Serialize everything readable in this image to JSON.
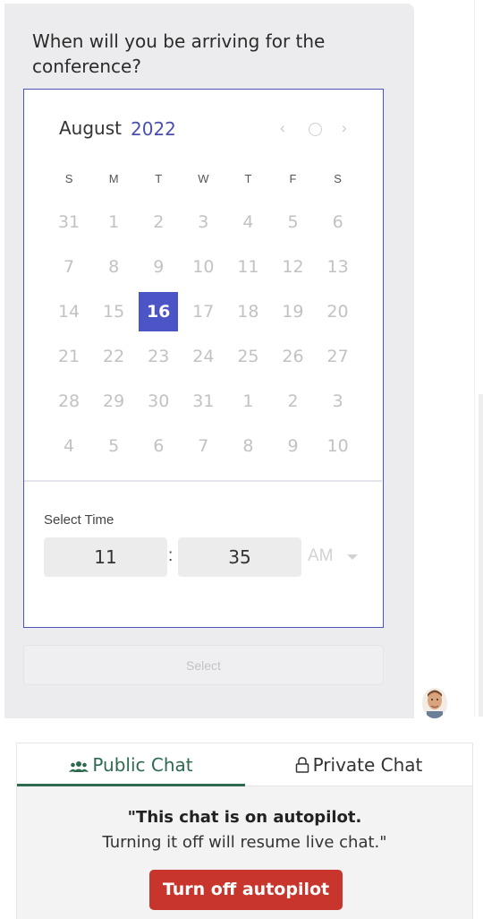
{
  "chat": {
    "question": "When will you be arriving for the conference?"
  },
  "calendar": {
    "month": "August",
    "year": "2022",
    "nav": {
      "prev": "‹",
      "next": "›"
    },
    "weekdays": [
      "S",
      "M",
      "T",
      "W",
      "T",
      "F",
      "S"
    ],
    "weeks": [
      [
        "31",
        "1",
        "2",
        "3",
        "4",
        "5",
        "6"
      ],
      [
        "7",
        "8",
        "9",
        "10",
        "11",
        "12",
        "13"
      ],
      [
        "14",
        "15",
        "16",
        "17",
        "18",
        "19",
        "20"
      ],
      [
        "21",
        "22",
        "23",
        "24",
        "25",
        "26",
        "27"
      ],
      [
        "28",
        "29",
        "30",
        "31",
        "1",
        "2",
        "3"
      ],
      [
        "4",
        "5",
        "6",
        "7",
        "8",
        "9",
        "10"
      ]
    ],
    "selected_day": "16",
    "accent_color": "#4b55c6"
  },
  "time": {
    "label": "Select Time",
    "hour": "11",
    "separator": ":",
    "minute": "35",
    "meridiem": "AM"
  },
  "actions": {
    "select_label": "Select"
  },
  "tabs": {
    "public": {
      "label": "Public Chat",
      "icon": "group-icon",
      "active": true,
      "color": "#2d6a4f"
    },
    "private": {
      "label": "Private Chat",
      "icon": "lock-icon",
      "active": false
    }
  },
  "autopilot": {
    "notice_line1": "\"This chat is on autopilot.",
    "notice_line2": "Turning it off will resume live chat.\"",
    "button_label": "Turn off autopilot",
    "button_color": "#c8352c"
  }
}
